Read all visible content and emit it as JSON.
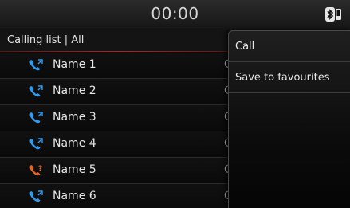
{
  "status": {
    "time": "00:00",
    "bluetooth_icon": "bluetooth-phone-icon"
  },
  "list": {
    "header": "Calling list | All",
    "rows": [
      {
        "name": "Name 1",
        "icon": "phone-call-icon",
        "icon_color": "#2e9cf2",
        "cut": "C"
      },
      {
        "name": "Name 2",
        "icon": "phone-call-icon",
        "icon_color": "#2e9cf2",
        "cut": "C"
      },
      {
        "name": "Name 3",
        "icon": "phone-call-icon",
        "icon_color": "#2e9cf2",
        "cut": "C"
      },
      {
        "name": "Name 4",
        "icon": "phone-call-icon",
        "icon_color": "#2e9cf2",
        "cut": "C"
      },
      {
        "name": "Name 5",
        "icon": "missed-call-icon",
        "icon_color": "#e8651e",
        "cut": "C"
      },
      {
        "name": "Name 6",
        "icon": "phone-call-icon",
        "icon_color": "#2e9cf2",
        "cut": "C"
      }
    ]
  },
  "popup": {
    "items": [
      {
        "label": "Call"
      },
      {
        "label": "Save to favourites"
      }
    ]
  },
  "colors": {
    "accent_line": "#b32222",
    "call_icon": "#2e9cf2",
    "missed_icon": "#e8651e"
  }
}
